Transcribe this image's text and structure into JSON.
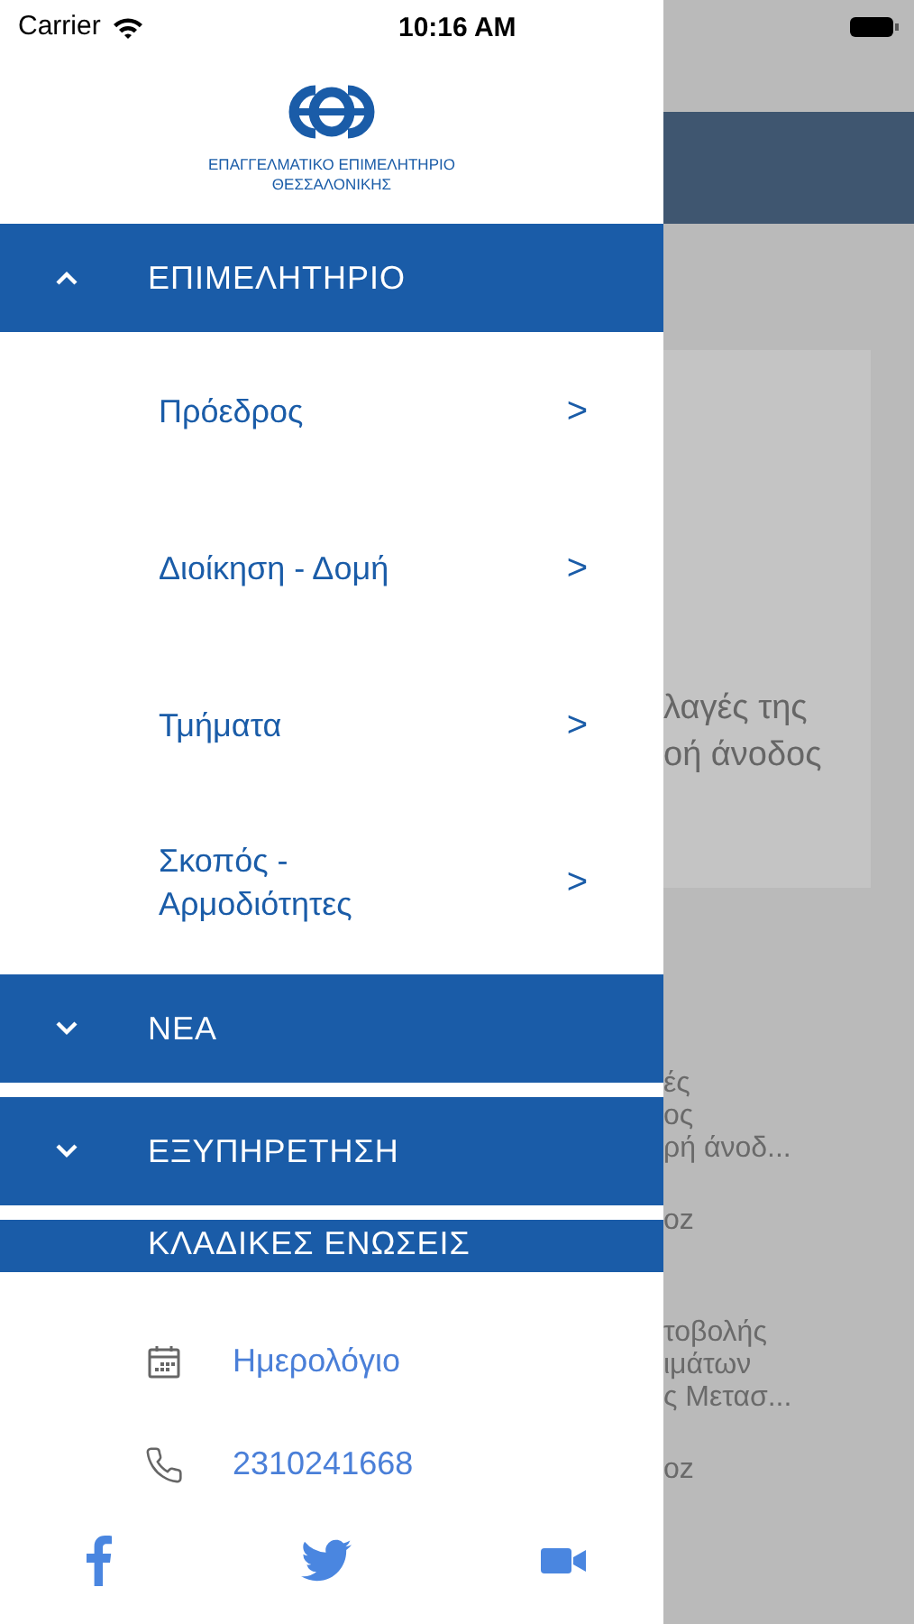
{
  "status_bar": {
    "carrier": "Carrier",
    "time": "10:16 AM"
  },
  "logo": {
    "line_1": "ΕΠΑΓΓΕΛΜΑΤΙΚΟ ΕΠΙΜΕΛΗΤΗΡΙΟ",
    "line_2": "ΘΕΣΣΑΛΟΝΙΚΗΣ"
  },
  "menu": [
    {
      "label": "ΕΠΙΜΕΛΗΤΗΡΙΟ",
      "expanded": true,
      "children": [
        {
          "label": "Πρόεδρος",
          "chevron": ">"
        },
        {
          "label": "Διοίκηση - Δομή",
          "chevron": ">"
        },
        {
          "label": "Τμήματα",
          "chevron": ">"
        },
        {
          "label": "Σκοπός - Αρμοδιότητες",
          "chevron": ">"
        }
      ]
    },
    {
      "label": "ΝΕΑ",
      "expanded": false
    },
    {
      "label": "ΕΞΥΠΗΡΕΤΗΣΗ",
      "expanded": false
    },
    {
      "label": "ΚΛΑΔΙΚΕΣ ΕΝΩΣΕΙΣ",
      "kind": "partial"
    }
  ],
  "contacts": [
    {
      "kind": "calendar",
      "label": "Ημερολόγιο"
    },
    {
      "kind": "phone",
      "label": "2310241668"
    }
  ],
  "social": [
    {
      "kind": "facebook"
    },
    {
      "kind": "twitter"
    },
    {
      "kind": "video"
    }
  ],
  "background": {
    "card_text": [
      "λαγές της",
      "οή άνοδος"
    ],
    "items": [
      [
        "ές",
        "ος",
        "ρή άνοδ..."
      ],
      [
        "οz"
      ],
      [
        "τοβολής",
        "ιμάτων",
        "ς Μετασ..."
      ],
      [
        "οz"
      ]
    ]
  }
}
